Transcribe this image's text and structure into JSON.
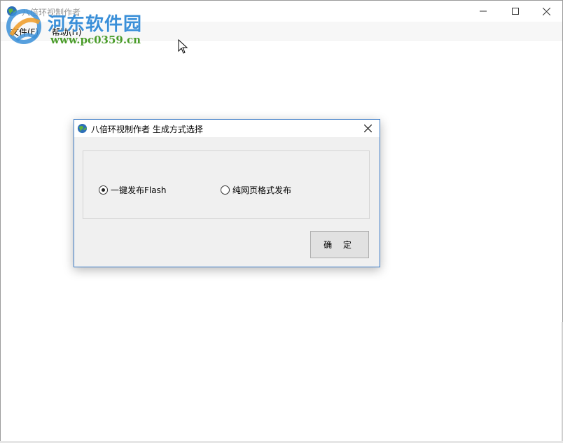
{
  "main_window": {
    "title": "八倍环视制作者",
    "menu": [
      {
        "label": "文件(F)"
      },
      {
        "label": "帮助(H)"
      }
    ]
  },
  "watermark": {
    "site_name_cn": "河东软件园",
    "url": "www.pc0359.cn"
  },
  "dialog": {
    "title": "八倍环视制作者 生成方式选择",
    "options": [
      {
        "label": "一键发布Flash",
        "selected": true
      },
      {
        "label": "纯网页格式发布",
        "selected": false
      }
    ],
    "ok_label": "确 定"
  },
  "colors": {
    "dialog_border": "#3b7bc6",
    "dialog_bg": "#f0f0f0",
    "watermark_blue": "#3a8fd8",
    "watermark_green": "#4a9c2a"
  },
  "icons": [
    "globe-icon",
    "minimize-icon",
    "maximize-icon",
    "close-icon",
    "mouse-cursor-icon"
  ]
}
